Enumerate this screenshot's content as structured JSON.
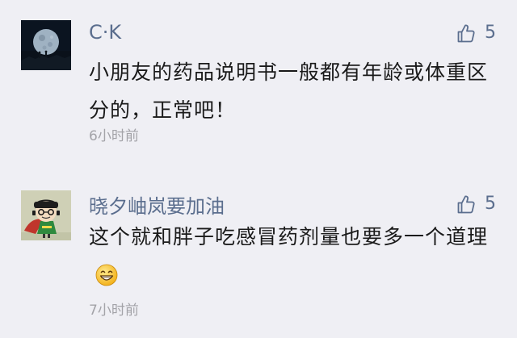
{
  "comments": [
    {
      "author": "C·K",
      "likes": "5",
      "text": "小朋友的药品说明书一般都有年龄或体重区分的，正常吧！",
      "time": "6小时前",
      "avatar_icon": "moon-night-avatar",
      "like_icon": "thumbs-up-icon"
    },
    {
      "author": "晓夕岫岚要加油",
      "likes": "5",
      "text": "这个就和胖子吃感冒药剂量也要多一个道理",
      "emoji": "grinning-face",
      "time": "7小时前",
      "avatar_icon": "cartoon-hero-avatar",
      "like_icon": "thumbs-up-icon"
    }
  ],
  "colors": {
    "background": "#efeff4",
    "name": "#5b6e8e",
    "text": "#1a1a1a",
    "time": "#a3a3a8"
  }
}
